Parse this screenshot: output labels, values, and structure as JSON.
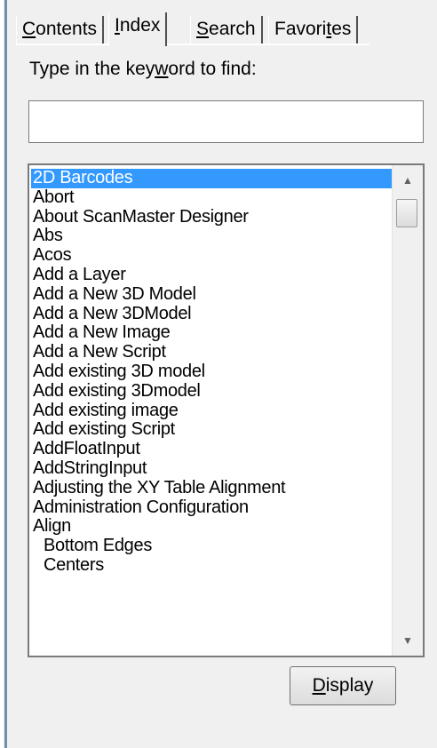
{
  "tabs": [
    {
      "label": "Contents",
      "mnemonic_index": 0,
      "active": false
    },
    {
      "label": "Index",
      "mnemonic_index": 0,
      "active": true
    },
    {
      "label": "Search",
      "mnemonic_index": 0,
      "active": false
    },
    {
      "label": "Favorites",
      "mnemonic_index": 6,
      "active": false
    }
  ],
  "prompt": {
    "before": "Type in the key",
    "underlined": "w",
    "after": "ord to find:"
  },
  "search": {
    "value": "",
    "placeholder": ""
  },
  "index_list": {
    "selected_index": 0,
    "items": [
      {
        "label": "2D Barcodes",
        "indent": false
      },
      {
        "label": "Abort",
        "indent": false
      },
      {
        "label": "About ScanMaster Designer",
        "indent": false
      },
      {
        "label": "Abs",
        "indent": false
      },
      {
        "label": "Acos",
        "indent": false
      },
      {
        "label": "Add a Layer",
        "indent": false
      },
      {
        "label": "Add a New 3D Model",
        "indent": false
      },
      {
        "label": "Add a New 3DModel",
        "indent": false
      },
      {
        "label": "Add a New Image",
        "indent": false
      },
      {
        "label": "Add a New Script",
        "indent": false
      },
      {
        "label": "Add existing 3D model",
        "indent": false
      },
      {
        "label": "Add existing 3Dmodel",
        "indent": false
      },
      {
        "label": "Add existing image",
        "indent": false
      },
      {
        "label": "Add existing Script",
        "indent": false
      },
      {
        "label": "AddFloatInput",
        "indent": false
      },
      {
        "label": "AddStringInput",
        "indent": false
      },
      {
        "label": "Adjusting the XY Table Alignment",
        "indent": false
      },
      {
        "label": "Administration Configuration",
        "indent": false
      },
      {
        "label": "Align",
        "indent": false
      },
      {
        "label": "Bottom Edges",
        "indent": true
      },
      {
        "label": "Centers",
        "indent": true
      }
    ]
  },
  "scrollbar": {
    "up_icon": "triangle-up",
    "down_icon": "triangle-down"
  },
  "display_button": {
    "underlined": "D",
    "rest": "isplay"
  },
  "colors": {
    "selection": "#3399ff",
    "window_bg": "#f0f0f0",
    "frame_accent": "#6f8fb3"
  }
}
